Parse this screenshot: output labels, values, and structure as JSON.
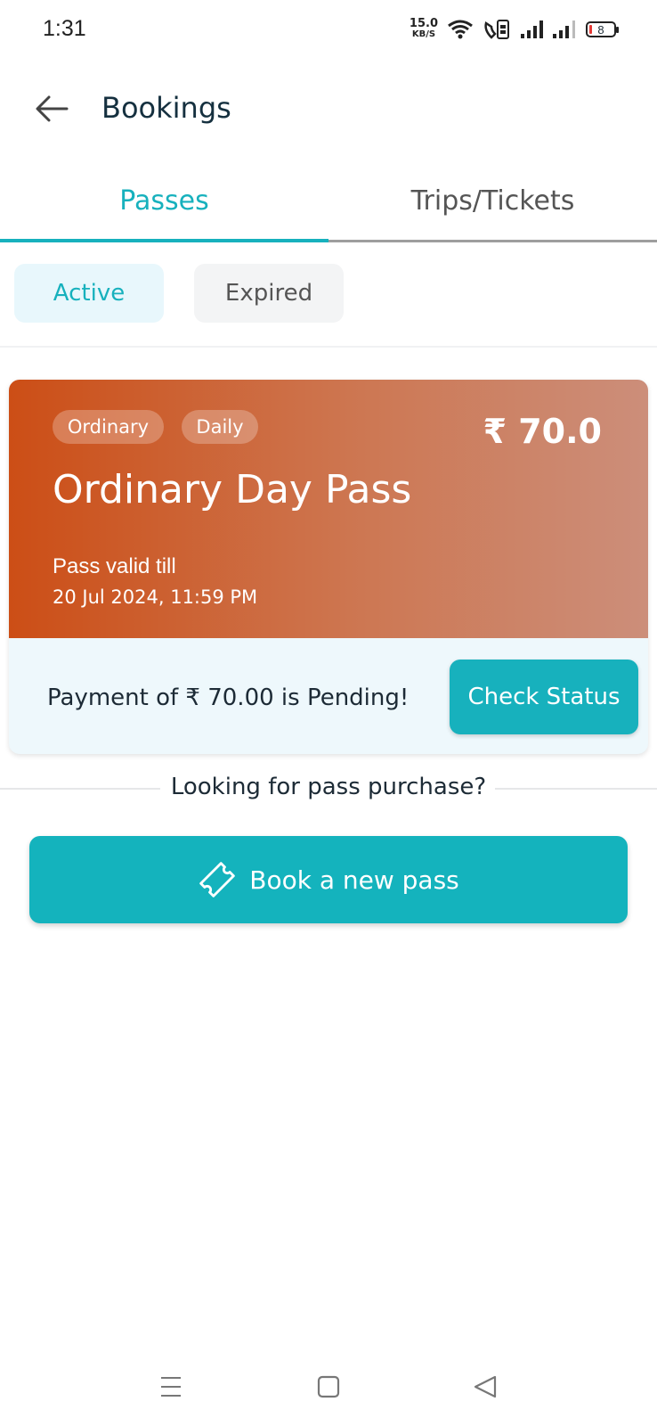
{
  "status_bar": {
    "time": "1:31",
    "net_speed": "15.0",
    "net_unit": "KB/S",
    "battery": "8",
    "icons": [
      "wifi-icon",
      "volte-icon",
      "signal-icon",
      "signal-icon",
      "battery-icon"
    ]
  },
  "header": {
    "back_icon": "arrow-left-icon",
    "title": "Bookings"
  },
  "tabs": [
    {
      "label": "Passes",
      "active": true
    },
    {
      "label": "Trips/Tickets",
      "active": false
    }
  ],
  "filters": [
    {
      "label": "Active",
      "selected": true
    },
    {
      "label": "Expired",
      "selected": false
    }
  ],
  "pass_card": {
    "tags": [
      "Ordinary",
      "Daily"
    ],
    "price": "₹ 70.0",
    "name": "Ordinary Day Pass",
    "valid_label": "Pass valid till",
    "valid_date": "20 Jul 2024, 11:59 PM",
    "payment_status": "Payment of ₹ 70.00 is Pending!",
    "check_button": "Check Status",
    "gradient_colors": [
      "#cc4e16",
      "#cc8e7a"
    ]
  },
  "separator_text": "Looking for pass purchase?",
  "book_button": {
    "label": "Book a new pass",
    "icon": "ticket-icon"
  },
  "nav_bar": {
    "icons": [
      "menu-icon",
      "home-icon",
      "back-icon"
    ]
  },
  "colors": {
    "accent": "#17b1bd",
    "text": "#1d2b36"
  }
}
